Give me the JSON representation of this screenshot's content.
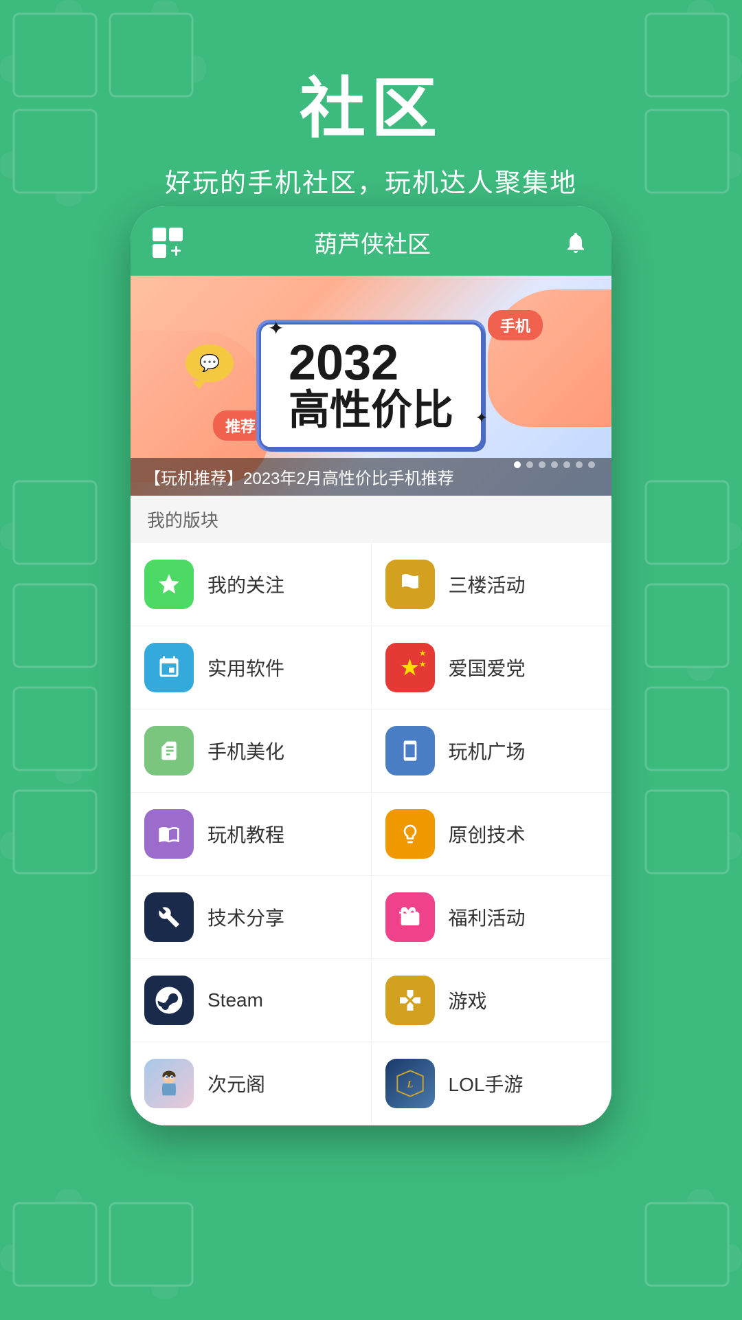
{
  "background": {
    "color": "#3dba7e"
  },
  "top": {
    "title": "社区",
    "subtitle": "好玩的手机社区，玩机达人聚集地"
  },
  "header": {
    "title": "葫芦侠社区",
    "grid_icon_label": "grid-plus-icon",
    "bell_icon_label": "bell-icon"
  },
  "banner": {
    "year": "2032",
    "main_text": "高性价比",
    "badge_recommend": "推荐",
    "badge_phone": "手机",
    "caption": "【玩机推荐】2023年2月高性价比手机推荐",
    "dots": [
      {
        "active": true
      },
      {
        "active": false
      },
      {
        "active": false
      },
      {
        "active": false
      },
      {
        "active": false
      },
      {
        "active": false
      },
      {
        "active": false
      }
    ]
  },
  "my_blocks": {
    "header": "我的版块",
    "items": [
      {
        "label": "我的关注",
        "icon": "star",
        "color": "green",
        "row": 0,
        "col": 0
      },
      {
        "label": "三楼活动",
        "icon": "flag",
        "color": "yellow-green",
        "row": 0,
        "col": 1
      },
      {
        "label": "实用软件",
        "icon": "cube",
        "color": "cyan",
        "row": 1,
        "col": 0
      },
      {
        "label": "爱国爱党",
        "icon": "china-flag",
        "color": "red",
        "row": 1,
        "col": 1
      },
      {
        "label": "手机美化",
        "icon": "book",
        "color": "light-green",
        "row": 2,
        "col": 0
      },
      {
        "label": "玩机广场",
        "icon": "phone",
        "color": "blue",
        "row": 2,
        "col": 1
      },
      {
        "label": "玩机教程",
        "icon": "book2",
        "color": "purple",
        "row": 3,
        "col": 0
      },
      {
        "label": "原创技术",
        "icon": "bulb",
        "color": "orange",
        "row": 3,
        "col": 1
      },
      {
        "label": "技术分享",
        "icon": "wrench",
        "color": "navy",
        "row": 4,
        "col": 0
      },
      {
        "label": "福利活动",
        "icon": "gift",
        "color": "pink",
        "row": 4,
        "col": 1
      },
      {
        "label": "Steam",
        "icon": "steam",
        "color": "dark-navy",
        "row": 5,
        "col": 0
      },
      {
        "label": "游戏",
        "icon": "game",
        "color": "gold",
        "row": 5,
        "col": 1
      },
      {
        "label": "次元阁",
        "icon": "anime",
        "color": "anime",
        "row": 6,
        "col": 0
      },
      {
        "label": "LOL手游",
        "icon": "lol",
        "color": "lol",
        "row": 6,
        "col": 1
      }
    ]
  }
}
